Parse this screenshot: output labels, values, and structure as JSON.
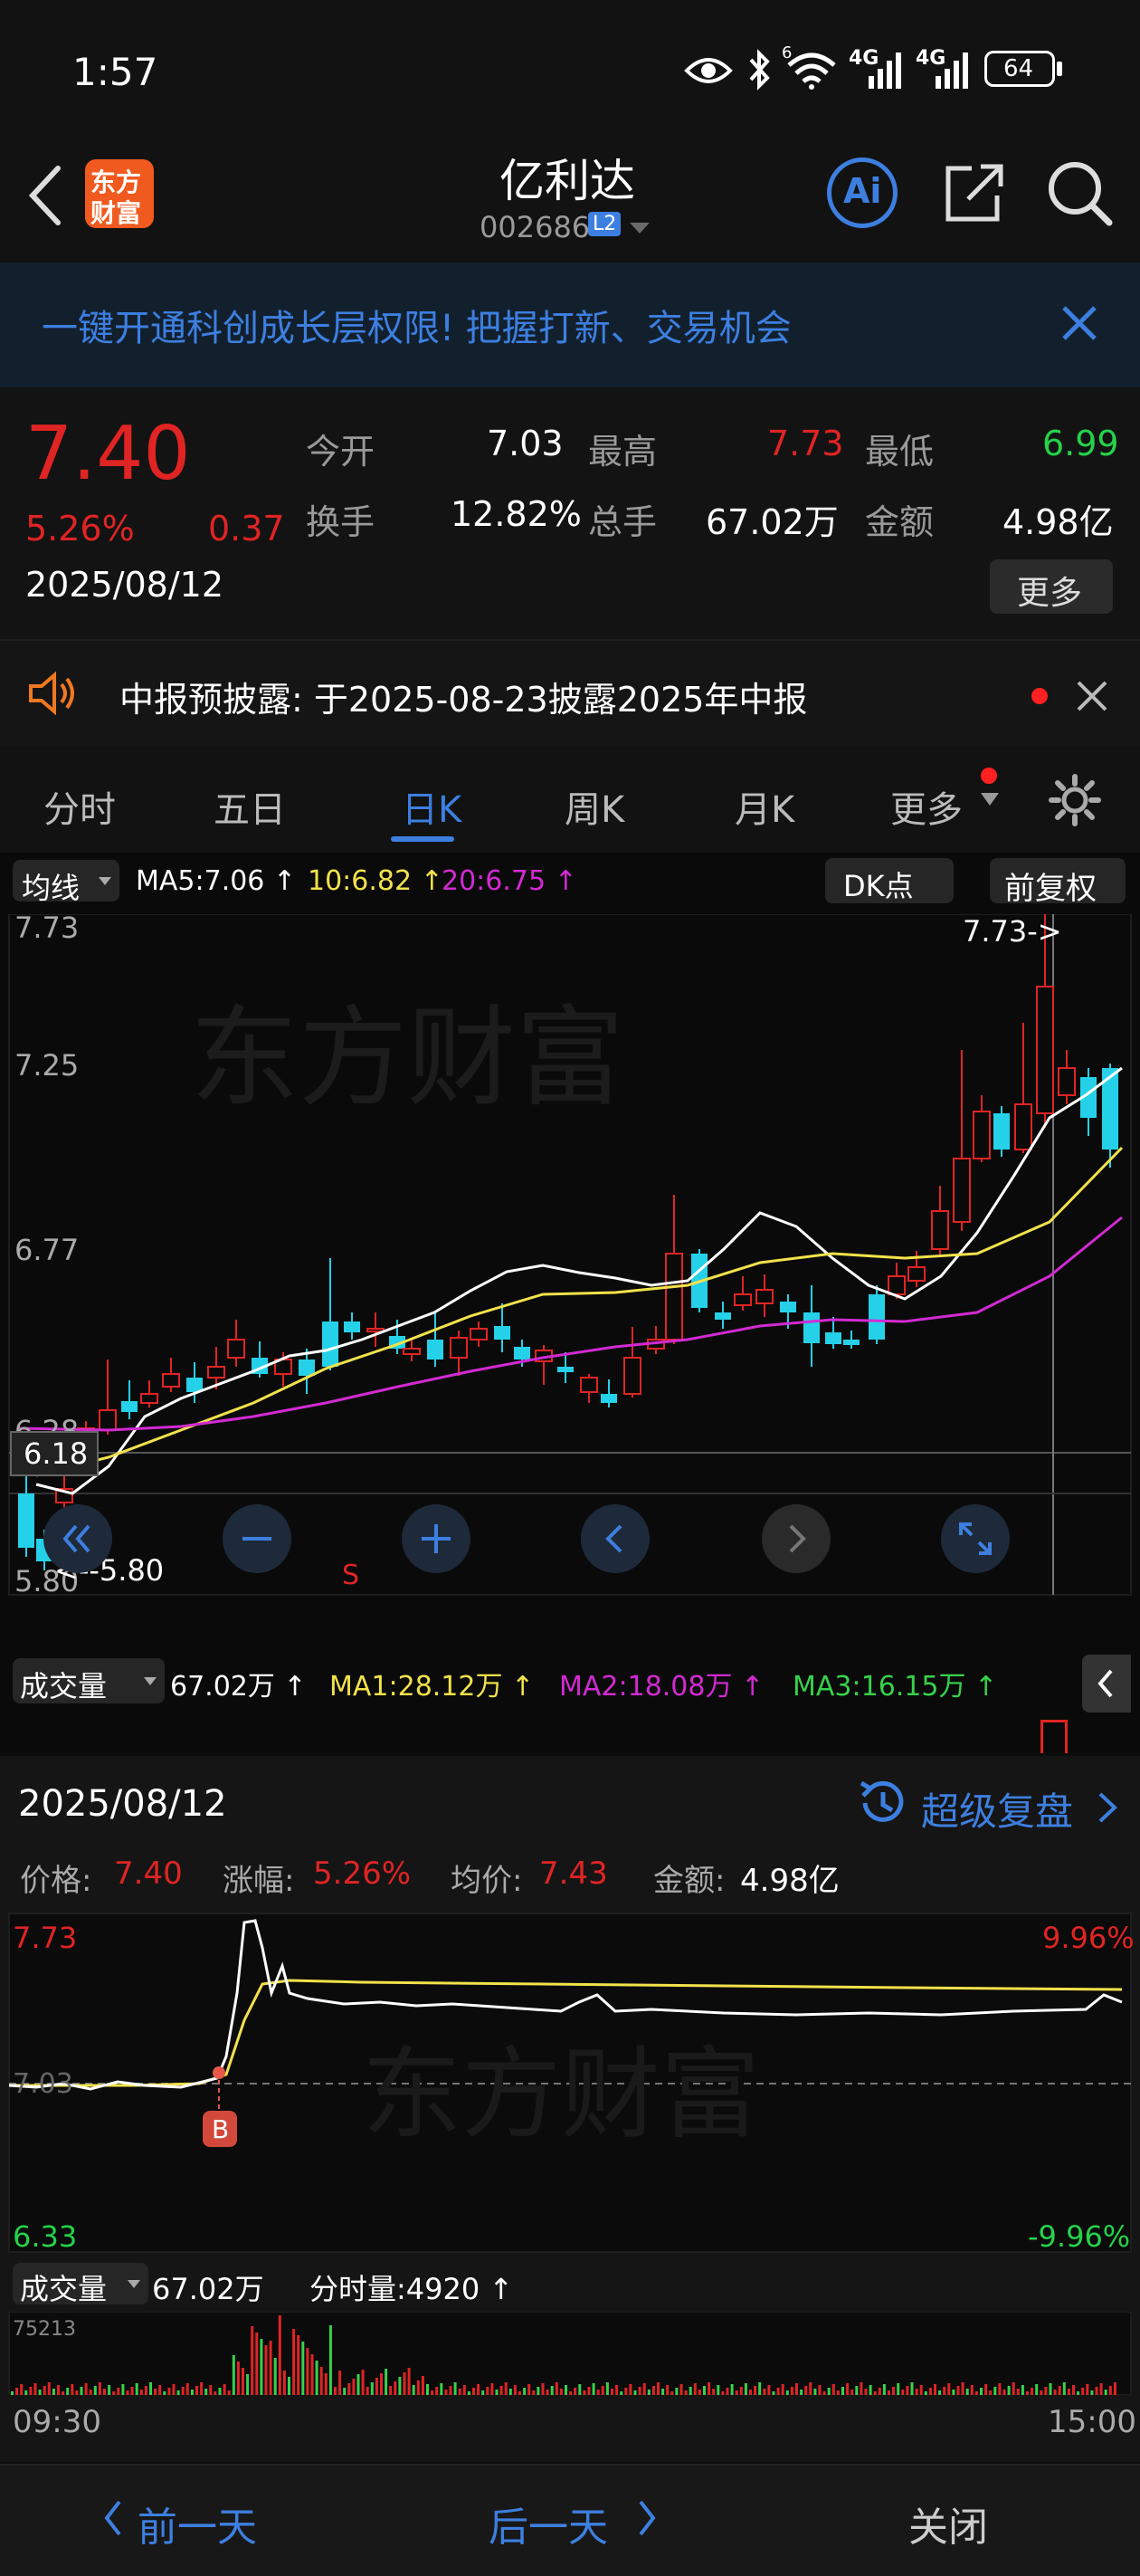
{
  "status_bar": {
    "time": "1:57",
    "network1": "4G",
    "network2": "4G",
    "wifi_badge": "6",
    "battery": "64"
  },
  "nav": {
    "logo_line1": "东方",
    "logo_line2": "财富",
    "stock_name": "亿利达",
    "stock_code": "002686",
    "level_badge": "L2",
    "ai_label": "Ai"
  },
  "banner": {
    "text": "一键开通科创成长层权限! 把握打新、交易机会"
  },
  "quote": {
    "price": "7.40",
    "change_pct": "5.26%",
    "change_amt": "0.37",
    "date": "2025/08/12",
    "open_label": "今开",
    "open": "7.03",
    "high_label": "最高",
    "high": "7.73",
    "low_label": "最低",
    "low": "6.99",
    "turnover_label": "换手",
    "turnover": "12.82%",
    "volume_label": "总手",
    "volume": "67.02万",
    "amount_label": "金额",
    "amount": "4.98亿",
    "more_button": "更多"
  },
  "notice": {
    "text": "中报预披露:  于2025-08-23披露2025年中报"
  },
  "tabs": [
    {
      "label": "分时",
      "active": false
    },
    {
      "label": "五日",
      "active": false
    },
    {
      "label": "日K",
      "active": true
    },
    {
      "label": "周K",
      "active": false
    },
    {
      "label": "月K",
      "active": false
    },
    {
      "label": "更多",
      "active": false
    }
  ],
  "kline": {
    "ma_selector": "均线",
    "ma5": "MA5:7.06 ↑",
    "ma10": "10:6.82 ↑",
    "ma20": "20:6.75 ↑",
    "dk_button": "DK点",
    "adjust_button": "前复权",
    "y_labels": [
      "7.73",
      "7.25",
      "6.77",
      "6.28",
      "5.80"
    ],
    "max_marker": "7.73->",
    "min_marker": "<--5.80",
    "crosshair_price": "6.18",
    "s_marker": "S",
    "volume_selector": "成交量",
    "vol_total": "67.02万 ↑",
    "vol_ma1": "MA1:28.12万 ↑",
    "vol_ma2": "MA2:18.08万 ↑",
    "vol_ma3": "MA3:16.15万 ↑"
  },
  "replay": {
    "date": "2025/08/12",
    "super_replay": "超级复盘",
    "price_label": "价格:",
    "price": "7.40",
    "change_label": "涨幅:",
    "change": "5.26%",
    "avg_label": "均价:",
    "avg": "7.43",
    "amount_label": "金额:",
    "amount": "4.98亿",
    "y_top": "7.73",
    "y_mid": "7.03",
    "y_bottom": "6.33",
    "pct_top": "9.96%",
    "pct_bottom": "-9.96%",
    "buy_marker": "B",
    "volume_selector": "成交量",
    "volume": "67.02万",
    "minute_volume": "分时量:4920 ↑",
    "vol_max": "75213",
    "time_start": "09:30",
    "time_end": "15:00"
  },
  "footer": {
    "prev_day": "前一天",
    "next_day": "后一天",
    "close": "关闭"
  },
  "colors": {
    "up": "#e02424",
    "down": "#25d1e8",
    "accent": "#3d7fe0",
    "ma5": "#ffffff",
    "ma10": "#f2e24b",
    "ma20": "#d22ad2",
    "ma3": "#36d24a"
  }
}
